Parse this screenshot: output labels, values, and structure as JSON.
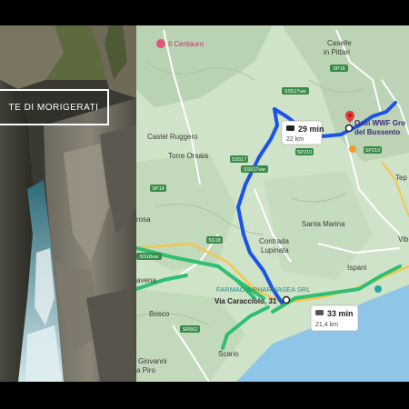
{
  "photo": {
    "banner_text": "TE DI  MORIGERATI"
  },
  "map": {
    "places": {
      "centauro": "Il Centauro",
      "caselle": "Caselle",
      "pittari": "in Pittari",
      "castel_ruggero": "Castel Ruggero",
      "torre_orsaia": "Torre Orsaia",
      "santa_marina": "Santa Marina",
      "contrada": "Contrada",
      "lupinata": "Lupinata",
      "ispani": "Ispani",
      "bosco": "Bosco",
      "scario": "Scario",
      "giovanni": "Giovanni",
      "piro": "a Piro",
      "cavena": "avena",
      "rosa": "rosa",
      "vib": "Vib",
      "tep": "Tep"
    },
    "destination": {
      "line1": "Oasi WWF Gro",
      "line2": "del Bussento"
    },
    "origin": "Via Caracciolo, 31",
    "pharmacy": "FARMACIA PHARMASEA SRL",
    "roads": {
      "sp16": "SP16",
      "ss517var_top": "SS517var",
      "sp210a": "SP210",
      "sp210b": "SP210",
      "ss517": "SS517",
      "ss517var_mid": "SS517var",
      "sp19": "SP19",
      "ss18": "SS18",
      "ss18var": "SS18var",
      "sr562": "SR562",
      "sp16b": "SP16"
    },
    "route_primary": {
      "time": "29 min",
      "distance": "22 km",
      "color": "#1a53e8"
    },
    "route_alt": {
      "time": "33 min",
      "distance": "21,4 km",
      "color": "#2fbf71"
    },
    "colors": {
      "sea": "#8fc6e8",
      "land": "#cfe3c9",
      "road_yellow": "#f3c64c"
    }
  }
}
